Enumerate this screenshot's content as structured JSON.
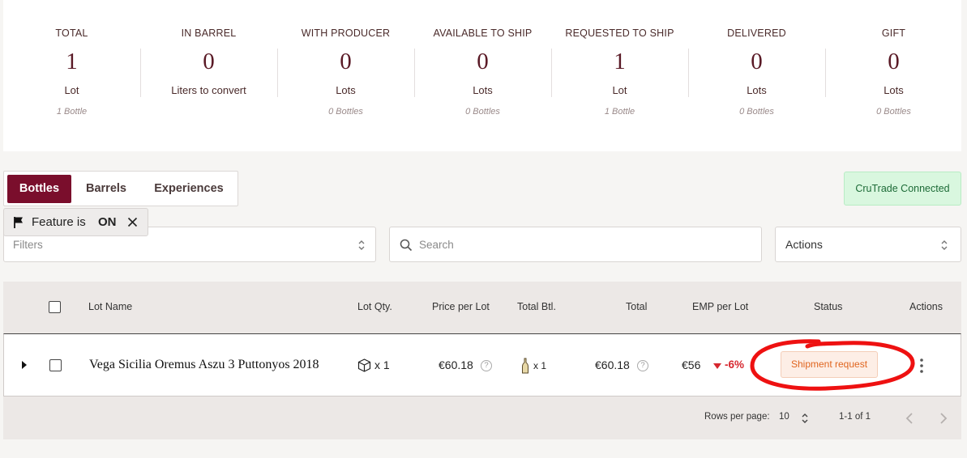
{
  "stats": [
    {
      "label": "TOTAL",
      "value": "1",
      "unit": "Lot",
      "sub": "1 Bottle"
    },
    {
      "label": "IN BARREL",
      "value": "0",
      "unit": "Liters to convert",
      "sub": ""
    },
    {
      "label": "WITH PRODUCER",
      "value": "0",
      "unit": "Lots",
      "sub": "0 Bottles"
    },
    {
      "label": "AVAILABLE TO SHIP",
      "value": "0",
      "unit": "Lots",
      "sub": "0 Bottles"
    },
    {
      "label": "REQUESTED TO SHIP",
      "value": "1",
      "unit": "Lot",
      "sub": "1 Bottle"
    },
    {
      "label": "DELIVERED",
      "value": "0",
      "unit": "Lots",
      "sub": "0 Bottles"
    },
    {
      "label": "GIFT",
      "value": "0",
      "unit": "Lots",
      "sub": "0 Bottles"
    }
  ],
  "tabs": [
    {
      "label": "Bottles",
      "active": true
    },
    {
      "label": "Barrels",
      "active": false
    },
    {
      "label": "Experiences",
      "active": false
    }
  ],
  "crutrade_label": "CruTrade Connected",
  "feature": {
    "text": "Feature is",
    "state": "ON"
  },
  "filters": {
    "placeholder": "Filters"
  },
  "search": {
    "placeholder": "Search"
  },
  "actions_select": {
    "value": "Actions"
  },
  "table": {
    "columns": [
      "Lot Name",
      "Lot Qty.",
      "Price per Lot",
      "Total Btl.",
      "Total",
      "EMP per Lot",
      "Status",
      "Actions"
    ],
    "rows": [
      {
        "lot_name": "Vega Sicilia Oremus Aszu 3 Puttonyos 2018",
        "lot_qty": "x 1",
        "price_per_lot": "€60.18",
        "total_btl": "x 1",
        "total": "€60.18",
        "emp_per_lot": "€56",
        "emp_change": "-6%",
        "status": "Shipment request"
      }
    ]
  },
  "pagination": {
    "rows_per_page_label": "Rows per page:",
    "rows_per_page": "10",
    "range": "1-1 of 1"
  },
  "colors": {
    "accent": "#7a0e2c",
    "status_orange": "#e0651f",
    "negative": "#d6272f",
    "annotation": "#ee1111"
  }
}
